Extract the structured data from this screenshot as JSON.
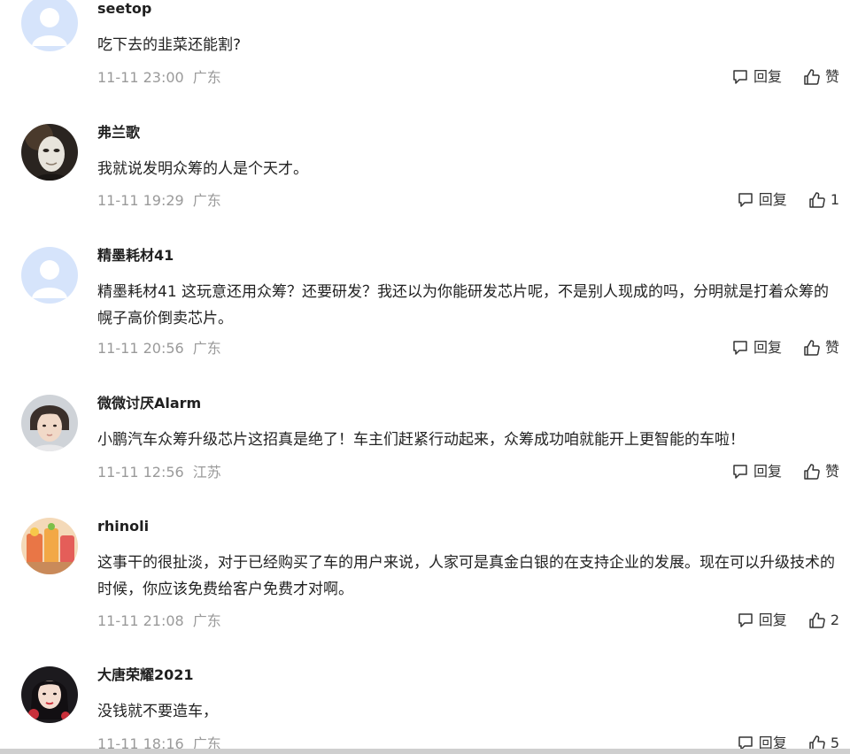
{
  "comments": [
    {
      "username": "seetop",
      "text": "吃下去的韭菜还能割?",
      "time": "11-11 23:00",
      "location": "广东",
      "reply_label": "回复",
      "like_label": "赞",
      "avatar": "default-person-icon"
    },
    {
      "username": "弗兰歌",
      "text": "我就说发明众筹的人是个天才。",
      "time": "11-11 19:29",
      "location": "广东",
      "reply_label": "回复",
      "like_label": "1",
      "avatar": "masked-face-photo"
    },
    {
      "username": "精墨耗材41",
      "text": "精墨耗材41 这玩意还用众筹？还要研发？我还以为你能研发芯片呢，不是别人现成的吗，分明就是打着众筹的幌子高价倒卖芯片。",
      "time": "11-11 20:56",
      "location": "广东",
      "reply_label": "回复",
      "like_label": "赞",
      "avatar": "default-person-icon"
    },
    {
      "username": "微微讨厌Alarm",
      "text": "小鹏汽车众筹升级芯片这招真是绝了！车主们赶紧行动起来，众筹成功咱就能开上更智能的车啦！",
      "time": "11-11 12:56",
      "location": "江苏",
      "reply_label": "回复",
      "like_label": "赞",
      "avatar": "young-person-photo"
    },
    {
      "username": "rhinoli",
      "text": "这事干的很扯淡，对于已经购买了车的用户来说，人家可是真金白银的在支持企业的发展。现在可以升级技术的时候，你应该免费给客户免费才对啊。",
      "time": "11-11 21:08",
      "location": "广东",
      "reply_label": "回复",
      "like_label": "2",
      "avatar": "drinks-photo"
    },
    {
      "username": "大唐荣耀2021",
      "text": "没钱就不要造车，",
      "time": "11-11 18:16",
      "location": "广东",
      "reply_label": "回复",
      "like_label": "5",
      "avatar": "woman-portrait-photo"
    }
  ],
  "colors": {
    "meta": "#9a9a9a",
    "text": "#222222",
    "default_avatar_bg": "#d6e4fb",
    "default_avatar_fg": "#ffffff"
  }
}
